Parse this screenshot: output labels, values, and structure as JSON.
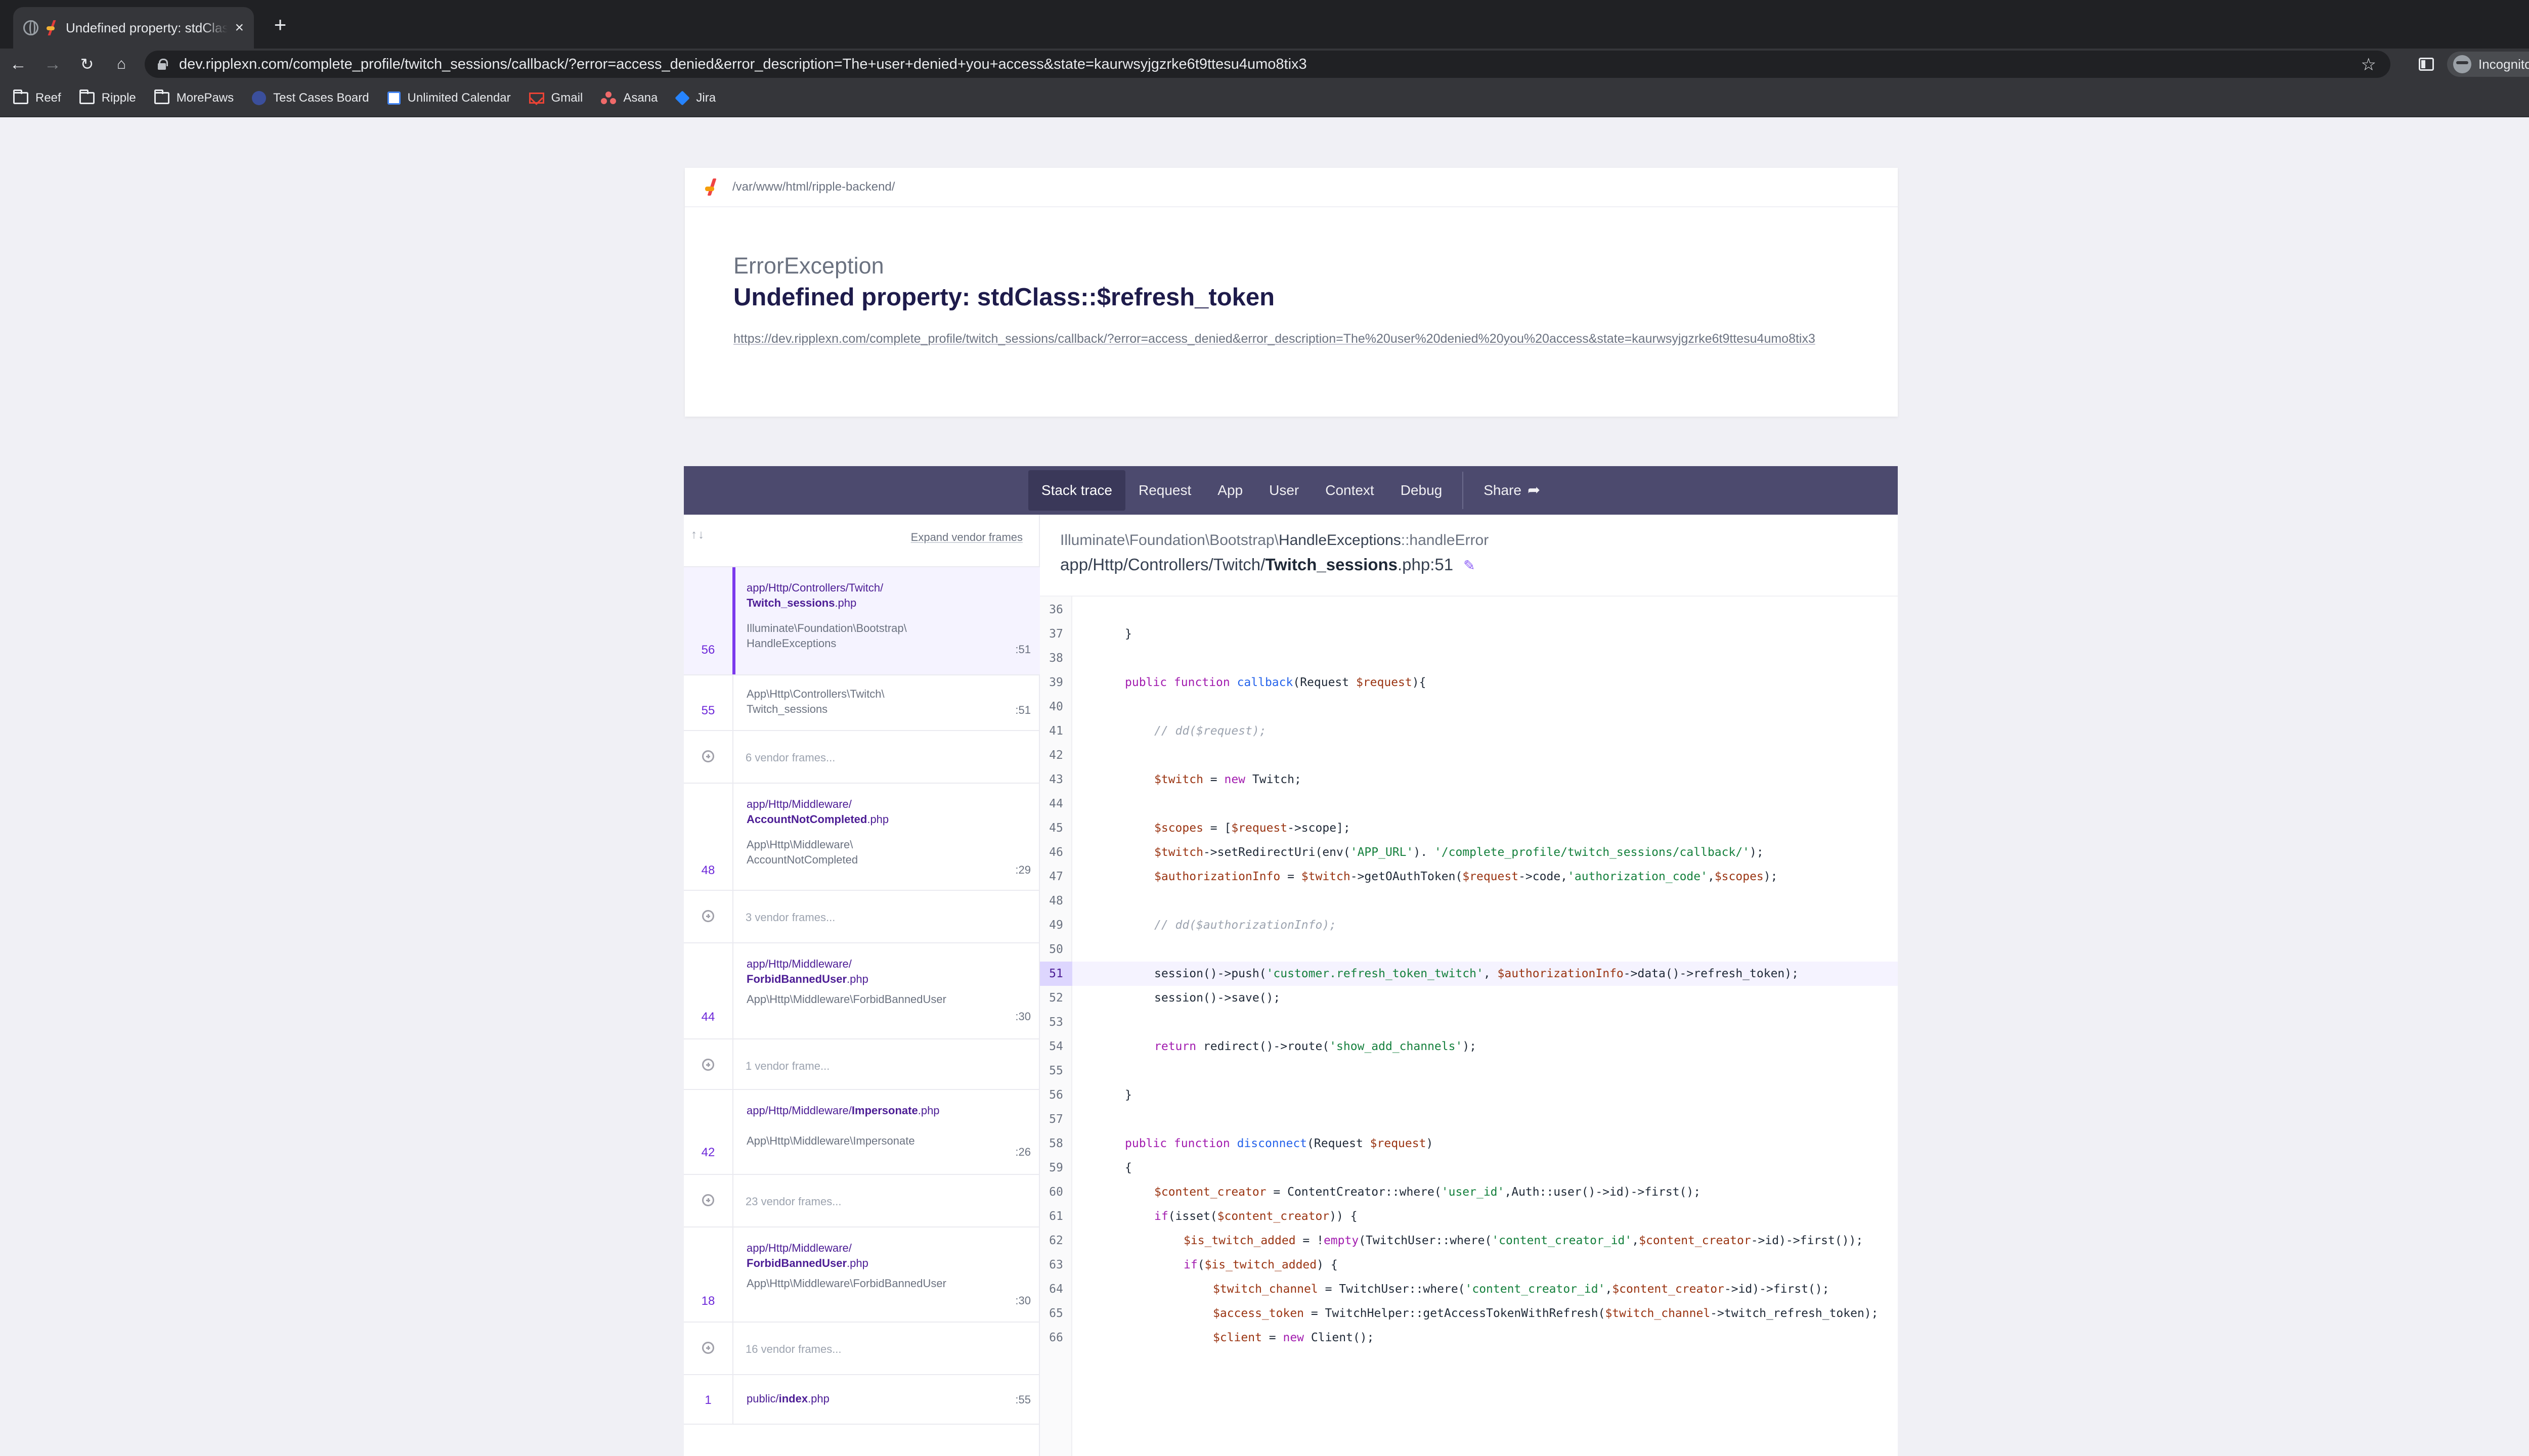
{
  "browser": {
    "tab_title": "Undefined property: stdClass::$refresh_token",
    "tab_close": "×",
    "new_tab": "+",
    "tab_search": "⌄",
    "url": "dev.ripplexn.com/complete_profile/twitch_sessions/callback/?error=access_denied&error_description=The+user+denied+you+access&state=kaurwsyjgzrke6t9ttesu4umo8tix3",
    "incognito_label": "Incognito",
    "bookmarks": [
      {
        "label": "Reef",
        "icon": "folder-icon"
      },
      {
        "label": "Ripple",
        "icon": "folder-icon"
      },
      {
        "label": "MorePaws",
        "icon": "folder-icon"
      },
      {
        "label": "Test Cases Board",
        "icon": "board-icon"
      },
      {
        "label": "Unlimited Calendar",
        "icon": "calendar-icon"
      },
      {
        "label": "Gmail",
        "icon": "gmail-icon"
      },
      {
        "label": "Asana",
        "icon": "asana-icon"
      },
      {
        "label": "Jira",
        "icon": "jira-icon"
      }
    ]
  },
  "error": {
    "path": "/var/www/html/ripple-backend/",
    "exception_class": "ErrorException",
    "message": "Undefined property: stdClass::$refresh_token",
    "request_url": "https://dev.ripplexn.com/complete_profile/twitch_sessions/callback/?error=access_denied&error_description=The%20user%20denied%20you%20access&state=kaurwsyjgzrke6t9ttesu4umo8tix3"
  },
  "tabs": [
    "Stack trace",
    "Request",
    "App",
    "User",
    "Context",
    "Debug"
  ],
  "share_label": "Share",
  "frames_header": {
    "arrows": "↑↓",
    "expand": "Expand vendor frames"
  },
  "frames": {
    "f56": {
      "num": "56",
      "file_dir": "app/Http/Controllers/Twitch/",
      "file_name": "Twitch_sessions",
      "file_ext": ".php",
      "cls1": "Illuminate\\Foundation\\Bootstrap\\",
      "cls2": "HandleExceptions",
      "line": ":51"
    },
    "f55": {
      "num": "55",
      "cls1": "App\\Http\\Controllers\\Twitch\\",
      "cls2": "Twitch_sessions",
      "line": ":51"
    },
    "v6": "6 vendor frames...",
    "f48": {
      "num": "48",
      "file_dir": "app/Http/Middleware/",
      "file_name": "AccountNotCompleted",
      "file_ext": ".php",
      "cls1": "App\\Http\\Middleware\\",
      "cls2": "AccountNotCompleted",
      "line": ":29"
    },
    "v3": "3 vendor frames...",
    "f44": {
      "num": "44",
      "file_dir": "app/Http/Middleware/",
      "file_name": "ForbidBannedUser",
      "file_ext": ".php",
      "cls": "App\\Http\\Middleware\\ForbidBannedUser",
      "line": ":30"
    },
    "v1": "1 vendor frame...",
    "f42": {
      "num": "42",
      "file_dir": "app/Http/Middleware/",
      "file_name": "Impersonate",
      "file_ext": ".php",
      "cls": "App\\Http\\Middleware\\Impersonate",
      "line": ":26"
    },
    "v23": "23 vendor frames...",
    "f18": {
      "num": "18",
      "file_dir": "app/Http/Middleware/",
      "file_name": "ForbidBannedUser",
      "file_ext": ".php",
      "cls": "App\\Http\\Middleware\\ForbidBannedUser",
      "line": ":30"
    },
    "v16": "16 vendor frames...",
    "f1": {
      "num": "1",
      "file_dir": "public/",
      "file_name": "index",
      "file_ext": ".php",
      "line": ":55"
    }
  },
  "code_header": {
    "cls_prefix": "Illuminate\\Foundation\\Bootstrap\\",
    "cls_name": "HandleExceptions",
    "cls_method": "::handleError",
    "file_dir": "app/Http/Controllers/Twitch/",
    "file_name": "Twitch_sessions",
    "file_suffix": ".php:51"
  },
  "code_lines": [
    "36",
    "37",
    "38",
    "39",
    "40",
    "41",
    "42",
    "43",
    "44",
    "45",
    "46",
    "47",
    "48",
    "49",
    "50",
    "51",
    "52",
    "53",
    "54",
    "55",
    "56",
    "57",
    "58",
    "59",
    "60",
    "61",
    "62",
    "63",
    "64",
    "65",
    "66"
  ],
  "highlighted_line": "51",
  "code": {
    "l37": "}",
    "l39_kw": "public function ",
    "l39_fn": "callback",
    "l39_a": "(Request ",
    "l39_v": "$request",
    "l39_b": "){",
    "l41": "// dd($request);",
    "l43_v": "$twitch",
    "l43_a": " = ",
    "l43_kw": "new",
    "l43_b": " Twitch;",
    "l45_v1": "$scopes",
    "l45_a": " = [",
    "l45_v2": "$request",
    "l45_b": "->scope];",
    "l46_v1": "$twitch",
    "l46_a": "->setRedirectUri(env(",
    "l46_s1": "'APP_URL'",
    "l46_b": "). ",
    "l46_s2": "'/complete_profile/twitch_sessions/callback/'",
    "l46_c": ");",
    "l47_v1": "$authorizationInfo",
    "l47_a": " = ",
    "l47_v2": "$twitch",
    "l47_b": "->getOAuthToken(",
    "l47_v3": "$request",
    "l47_c": "->code,",
    "l47_s": "'authorization_code'",
    "l47_d": ",",
    "l47_v4": "$scopes",
    "l47_e": ");",
    "l49": "// dd($authorizationInfo);",
    "l51_a": "session()->push(",
    "l51_s": "'customer.refresh_token_twitch'",
    "l51_b": ", ",
    "l51_v": "$authorizationInfo",
    "l51_c": "->data()->refresh_token);",
    "l52": "session()->save();",
    "l54_kw": "return",
    "l54_a": " redirect()->route(",
    "l54_s": "'show_add_channels'",
    "l54_b": ");",
    "l56": "}",
    "l58_kw": "public function ",
    "l58_fn": "disconnect",
    "l58_a": "(Request ",
    "l58_v": "$request",
    "l58_b": ")",
    "l59": "{",
    "l60_v": "$content_creator",
    "l60_a": " = ContentCreator::where(",
    "l60_s": "'user_id'",
    "l60_b": ",Auth::user()->id)->first();",
    "l61_kw": "if",
    "l61_a": "(isset(",
    "l61_v": "$content_creator",
    "l61_b": ")) {",
    "l62_v1": "$is_twitch_added",
    "l62_a": " = !",
    "l62_kw": "empty",
    "l62_b": "(TwitchUser::where(",
    "l62_s": "'content_creator_id'",
    "l62_c": ",",
    "l62_v2": "$content_creator",
    "l62_d": "->id)->first());",
    "l63_kw": "if",
    "l63_a": "(",
    "l63_v": "$is_twitch_added",
    "l63_b": ") {",
    "l64_v1": "$twitch_channel",
    "l64_a": " = TwitchUser::where(",
    "l64_s": "'content_creator_id'",
    "l64_b": ",",
    "l64_v2": "$content_creator",
    "l64_c": "->id)->first();",
    "l65_v1": "$access_token",
    "l65_a": " = TwitchHelper::getAccessTokenWithRefresh(",
    "l65_v2": "$twitch_channel",
    "l65_b": "->twitch_refresh_token);",
    "l66_v": "$client",
    "l66_a": " = ",
    "l66_kw": "new",
    "l66_b": " Client();"
  }
}
